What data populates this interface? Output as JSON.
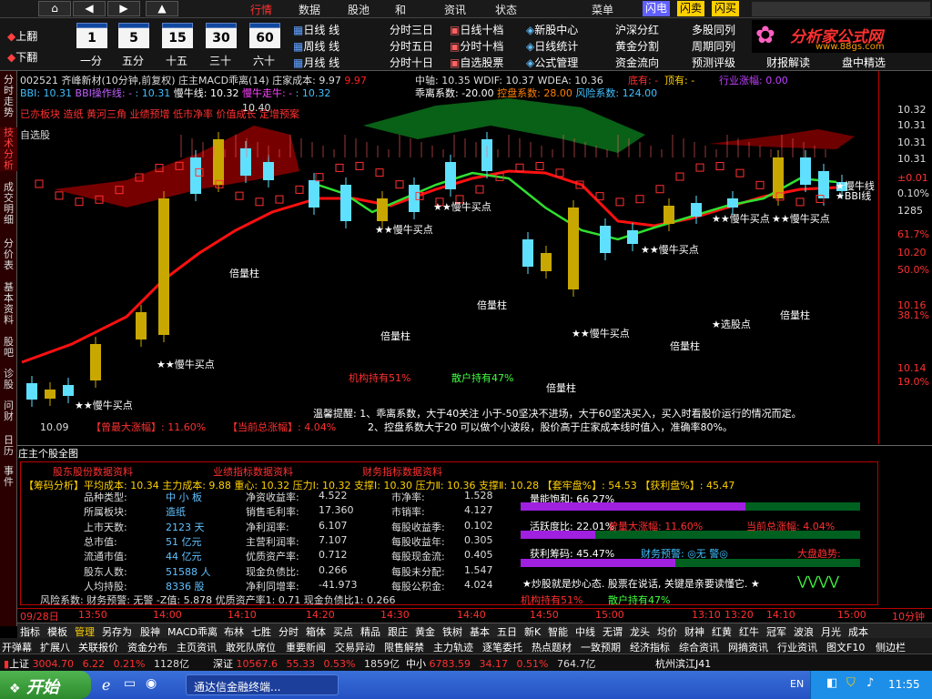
{
  "menu": {
    "nav_prev": "◀",
    "nav_next": "▶",
    "nav_up": "▲",
    "items": [
      "行情",
      "数据",
      "股池",
      "和",
      "资讯",
      "状态",
      "菜单"
    ],
    "flash": [
      "闪电",
      "闪卖",
      "闪买"
    ]
  },
  "toolbar": {
    "page_up": "上翻",
    "page_down": "下翻",
    "calendars": [
      {
        "day": "1",
        "label": "一分"
      },
      {
        "day": "5",
        "label": "五分"
      },
      {
        "day": "15",
        "label": "十五"
      },
      {
        "day": "30",
        "label": "三十"
      },
      {
        "day": "60",
        "label": "六十"
      }
    ],
    "col1": [
      "日线",
      "周线",
      "月线"
    ],
    "col2": [
      "分时三日",
      "分时五日",
      "分时十日"
    ],
    "col3": [
      "日线十档",
      "分时十档",
      "自选股票"
    ],
    "col4": [
      "新股中心",
      "日线统计",
      "公式管理"
    ],
    "col5": [
      "沪深分红",
      "黄金分割",
      "资金流向"
    ],
    "col6": [
      "多股同列",
      "周期同列",
      "预测评级"
    ],
    "col7": [
      "财报解读",
      "盘中精选"
    ],
    "logo_title": "分析家公式网",
    "logo_url": "www.88gs.com"
  },
  "left_tabs": [
    "分时走势",
    "技术分析",
    "成交明细",
    "分价表",
    "基本资料",
    "股吧",
    "诊股",
    "问财",
    "日历",
    "事件"
  ],
  "chart": {
    "header_line1": "002521 齐峰新材(10分钟,前复权) 庄主MACD乖离(14)",
    "cost_label": "庄家成本: 9.97",
    "cost_val": "9.97",
    "zhongzhou": "中轴: 10.35",
    "wdif": "WDIF: 10.37",
    "wdea": "WDEA: 10.36",
    "di_you": "底有: -",
    "ding_you": "顶有: -",
    "industry": "行业涨幅: 0.00",
    "bbi": "BBI: 10.31",
    "bbi_op": "BBI操作线: -",
    "bbi_v": ": 10.31",
    "slow_bull": "慢牛线: 10.32",
    "slow_bull2": "慢牛走牛: -",
    "slow_v": ": 10.32",
    "qianli": "乖离系数: -20.00",
    "kongpan": "控盘系数: 28.00",
    "risk": "风险系数: 124.00",
    "signals": "已亦板块 造纸 黄河三角 业绩预增 低市净率 价值成长 定增预案",
    "self_sel": "自选股",
    "top_price": "10.40",
    "low_price": "10.09",
    "label_slow_buy": "★★慢牛买点",
    "label_double_vol": "倍量柱",
    "label_stock": "★选股点",
    "inst_hold": "机构持有51%",
    "retail_hold": "散户持有47%",
    "max_rise": "【曾最大涨幅】: 11.60%",
    "total_rise": "【当前总涨幅】: 4.04%",
    "tip1": "温馨提醒: 1、乖离系数，大于40关注 小于-50坚决不进场，大于60坚决买入，买入时看股价运行的情况而定。",
    "tip2": "2、控盘系数大于20 可以做个小波段，股价高于庄家成本线时值入，准确率80%。",
    "right_slow": "★慢牛线",
    "right_bbi": "★BBI线"
  },
  "right_scale": [
    {
      "v": "10.32",
      "c": "#ddd"
    },
    {
      "v": "10.31",
      "c": "#ddd"
    },
    {
      "v": "10.31",
      "c": "#ddd"
    },
    {
      "v": "10.31",
      "c": "#ddd"
    },
    {
      "v": "±0.01",
      "c": "#ff3030"
    },
    {
      "v": "0.10%",
      "c": "#ddd"
    },
    {
      "v": "1285",
      "c": "#ddd"
    },
    {
      "v": "61.7%",
      "c": "#ff3030"
    },
    {
      "v": "10.20",
      "c": "#ff3030"
    },
    {
      "v": "50.0%",
      "c": "#ff3030"
    },
    {
      "v": "10.16",
      "c": "#ff3030"
    },
    {
      "v": "38.1%",
      "c": "#ff3030"
    },
    {
      "v": "10.14",
      "c": "#ff3030"
    },
    {
      "v": "19.0%",
      "c": "#ff3030"
    }
  ],
  "bottom": {
    "title": "庄主个股全图",
    "sec1": "股东股份数据资料",
    "sec2": "业绩指标数据资料",
    "sec3": "财务指标数据资料",
    "chip_line": "【筹码分析】平均成本: 10.34 主力成本: 9.88 重心: 10.32 压力Ⅰ: 10.32 支撑Ⅰ: 10.30 压力Ⅱ: 10.36 支撑Ⅱ: 10.28 【套牢盘%】: 54.53 【获利盘%】: 45.47",
    "rows": [
      [
        "品种类型:",
        "中 小 板",
        "净资收益率:",
        "4.522",
        "市净率:",
        "1.528"
      ],
      [
        "所属板块:",
        "造纸",
        "销售毛利率:",
        "17.360",
        "市销率:",
        "4.127"
      ],
      [
        "上市天数:",
        "2123 天",
        "净利润率:",
        "6.107",
        "每股收益季:",
        "0.102"
      ],
      [
        "总市值:",
        "51 亿元",
        "主营利润率:",
        "7.107",
        "每股收益年:",
        "0.305"
      ],
      [
        "流通市值:",
        "44 亿元",
        "优质资产率:",
        "0.712",
        "每股现金流:",
        "0.405"
      ],
      [
        "股东人数:",
        "51588 人",
        "现金负债比:",
        "0.266",
        "每股未分配:",
        "1.547"
      ],
      [
        "人均持股:",
        "8336 股",
        "净利同增率:",
        "-41.973",
        "每股公积金:",
        "4.024"
      ]
    ],
    "energy": "量能饱和: 66.27%",
    "energy_pct": 66.27,
    "activity": "活跃度比: 22.01%",
    "activity_pct": 22.01,
    "max_rise": "曾量大涨幅: 11.60%",
    "cur_rise": "当前总涨幅: 4.04%",
    "profit": "获利筹码: 45.47%",
    "profit_pct": 45.47,
    "warn": "财务预警: ◎无 警◎",
    "trend": "大盘趋势:",
    "slogan": "★炒股就是炒心态. 股票在说话, 关键是亲要读懂它. ★",
    "footer": "风险系数: 财务预警: 无警 -Z值: 5.878   优质资产率1: 0.71   现金负债比1: 0.266",
    "inst": "机构持有51%",
    "retail": "散户持有47%"
  },
  "time_axis": [
    "09/28日",
    "13:50",
    "14:00",
    "14:10",
    "14:20",
    "14:30",
    "14:40",
    "14:50",
    "15:00",
    "13:10",
    "13:20",
    "14:10",
    "15:00",
    "10分钟"
  ],
  "tabs1": [
    "指标",
    "模板",
    "管理",
    "另存为",
    "股神",
    "MACD乖离",
    "布林",
    "七胜",
    "分时",
    "箱体",
    "买点",
    "精品",
    "跟庄",
    "黄金",
    "铁树",
    "基本",
    "五日",
    "新K",
    "智能",
    "中线",
    "无谓",
    "龙头",
    "均价",
    "财神",
    "红黄",
    "红牛",
    "冠军",
    "波浪",
    "月光",
    "成本"
  ],
  "tabs2": [
    "开弹幕",
    "扩展八",
    "关联报价",
    "资金分布",
    "主页资讯",
    "敢死队席位",
    "重要新闻",
    "交易异动",
    "限售解禁",
    "主力轨迹",
    "逐笔委托",
    "热点题材",
    "一致预期",
    "经济指标",
    "综合资讯",
    "网摘资讯",
    "行业资讯",
    "图文F10",
    "侧边栏"
  ],
  "status": {
    "sh_label": "上证",
    "sh_val": "3004.70",
    "sh_chg": "6.22",
    "sh_pct": "0.21%",
    "sh_amt": "1128亿",
    "sz_label": "深证",
    "sz_val": "10567.6",
    "sz_chg": "55.33",
    "sz_pct": "0.53%",
    "sz_amt": "1859亿",
    "zx_label": "中小",
    "zx_val": "6783.59",
    "zx_chg": "34.17",
    "zx_pct": "0.51%",
    "zx_amt": "764.7亿",
    "server": "杭州滨江J41"
  },
  "taskbar": {
    "start": "开始",
    "task": "通达信金融终端...",
    "lang": "EN",
    "time": "11:55"
  }
}
